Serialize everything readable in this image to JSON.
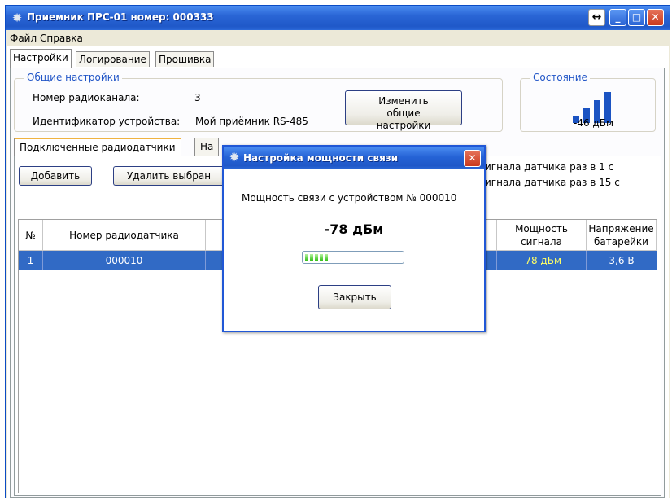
{
  "window": {
    "title": "Приемник ПРС-01 номер: 000333",
    "app_icon": "gear-icon",
    "resize_glyph": "↔",
    "minimize_glyph": "_",
    "maximize_glyph": "□",
    "close_glyph": "✕"
  },
  "menu": [
    "Файл",
    "Справка"
  ],
  "main_tabs": [
    "Настройки",
    "Логирование",
    "Прошивка"
  ],
  "general": {
    "title": "Общие настройки",
    "channel_label": "Номер радиоканала:",
    "channel_value": "3",
    "device_id_label": "Идентификатор устройства:",
    "device_id_value": "Мой приёмник RS-485",
    "change_button": "Изменить общие настройки"
  },
  "status": {
    "title": "Состояние",
    "signal_value": "-46 дБм",
    "signal_bars_active": 3,
    "signal_bars_total": 4
  },
  "sensor_tabs": [
    "Подключенные радиодатчики",
    "На"
  ],
  "toolbar": {
    "add": "Добавить",
    "delete": "Удалить выбран",
    "rate_1": "игнала датчика раз в 1 с",
    "rate_15": "игнала датчика раз в 15 с"
  },
  "table": {
    "columns": [
      "№",
      "Номер радиодатчика",
      "",
      "Мощность сигнала",
      "Напряжение батарейки"
    ],
    "rows": [
      {
        "no": "1",
        "sensor": "000010",
        "power": "-78 дБм",
        "battery": "3,6 В"
      }
    ]
  },
  "dialog": {
    "title": "Настройка мощности связи",
    "message": "Мощность связи с устройством № 000010",
    "power": "-78 дБм",
    "progress_fraction": 0.25,
    "close_button": "Закрыть",
    "close_glyph": "✕"
  },
  "colors": {
    "selection": "#316ac5",
    "power_highlight": "#ffff66",
    "accent": "#2256c7"
  }
}
